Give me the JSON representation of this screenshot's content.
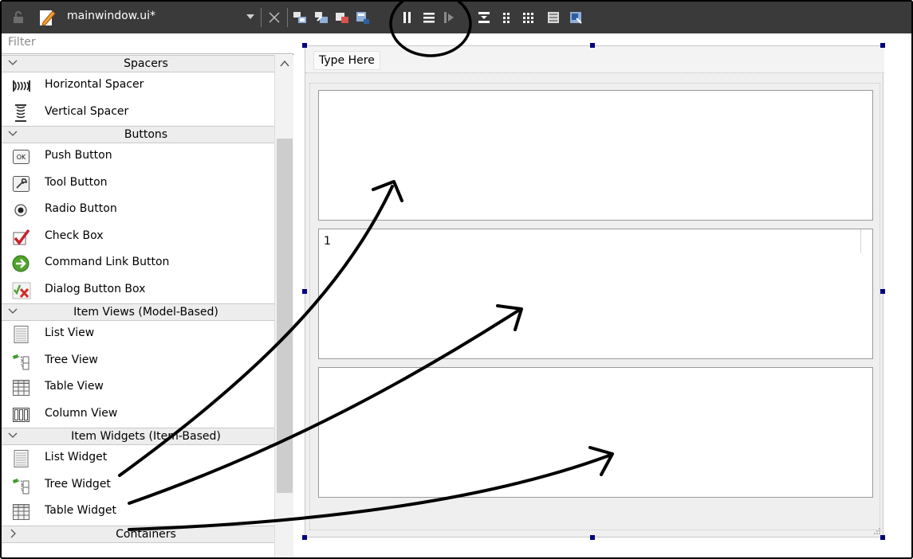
{
  "toolbar": {
    "file_title": "mainwindow.ui*",
    "icons": [
      "widget-editing-mode-icon",
      "signals-slots-mode-icon",
      "buddy-mode-icon",
      "tab-order-mode-icon",
      "lay-out-horizontally-icon",
      "lay-out-vertically-icon",
      "lay-out-horizontal-splitter-icon",
      "lay-out-vertical-splitter-icon",
      "lay-out-form-icon",
      "lay-out-grid-icon",
      "break-layout-icon",
      "adjust-size-icon"
    ]
  },
  "widget_box": {
    "filter_placeholder": "Filter",
    "sections": [
      {
        "label": "Spacers",
        "items": [
          "Horizontal Spacer",
          "Vertical Spacer"
        ]
      },
      {
        "label": "Buttons",
        "items": [
          "Push Button",
          "Tool Button",
          "Radio Button",
          "Check Box",
          "Command Link Button",
          "Dialog Button Box"
        ]
      },
      {
        "label": "Item Views (Model-Based)",
        "items": [
          "List View",
          "Tree View",
          "Table View",
          "Column View"
        ]
      },
      {
        "label": "Item Widgets (Item-Based)",
        "items": [
          "List Widget",
          "Tree Widget",
          "Table Widget"
        ]
      },
      {
        "label": "Containers",
        "items": []
      }
    ]
  },
  "form": {
    "menu_placeholder": "Type Here",
    "tree_header": "1"
  },
  "colors": {
    "toolbar_bg": "#3a3a3a",
    "handle": "#00007f",
    "category_bg": "#ededed",
    "form_bg": "#efefef"
  }
}
